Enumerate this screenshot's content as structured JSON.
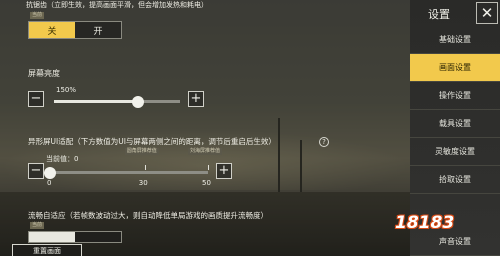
{
  "antialias": {
    "title": "抗锯齿（立即生效，提高画面平滑，但会增加发热和耗电）",
    "current_tag": "当前",
    "off_label": "关",
    "on_label": "开",
    "selected": "关"
  },
  "brightness": {
    "title": "屏幕亮度",
    "value_label": "150%",
    "value_percent": 150,
    "range_percent": [
      50,
      200
    ],
    "minus_label": "−",
    "plus_label": "+"
  },
  "notch": {
    "title": "异形屏UI适配（下方数值为UI与屏幕两侧之间的距离，调节后重启后生效）",
    "help_label": "?",
    "current_value_label": "当前值：0",
    "value": 0,
    "range": [
      0,
      50
    ],
    "tick_labels": [
      "0",
      "30",
      "50"
    ],
    "marker_labels": [
      "圆角屏推荐值",
      "刘海屏推荐值"
    ],
    "marker_values": [
      30,
      50
    ],
    "minus_label": "−",
    "plus_label": "+"
  },
  "smooth": {
    "title": "流畅自适应（若帧数波动过大，则自动降低单局游戏的画质提升流畅度）",
    "current_tag": "当前"
  },
  "reset_button": "重置画面",
  "sidebar": {
    "title": "设置",
    "close_label": "✕",
    "items": [
      {
        "label": "基础设置",
        "active": false
      },
      {
        "label": "画面设置",
        "active": true
      },
      {
        "label": "操作设置",
        "active": false
      },
      {
        "label": "载具设置",
        "active": false
      },
      {
        "label": "灵敏度设置",
        "active": false
      },
      {
        "label": "拾取设置",
        "active": false
      },
      {
        "label": "声音设置",
        "active": false
      }
    ]
  },
  "watermark": "18183",
  "colors": {
    "accent": "#f2c94c",
    "sidebar_bg": "#2a2a28",
    "logo_outline": "#d84a14"
  }
}
